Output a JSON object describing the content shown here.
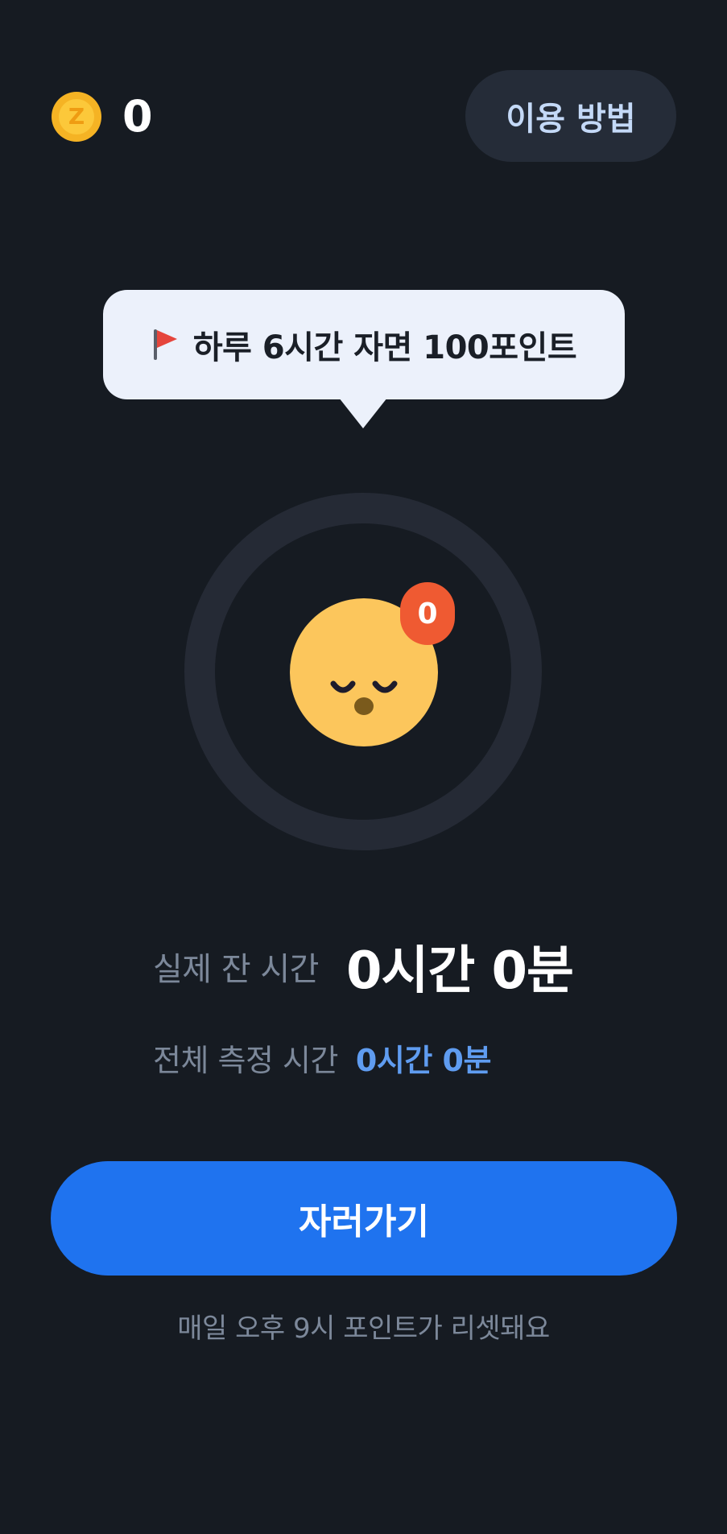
{
  "header": {
    "coin_symbol": "Z",
    "coin_count": "0",
    "help_label": "이용 방법"
  },
  "tooltip": {
    "icon": "flag-icon",
    "text": "하루 6시간 자면 100포인트"
  },
  "progress": {
    "face": "sleeping-face-icon",
    "badge_count": "0",
    "progress_fraction": 0
  },
  "stats": {
    "actual_sleep_label": "실제 잔 시간",
    "actual_sleep_value": "0시간 0분",
    "total_measured_label": "전체 측정 시간",
    "total_measured_value": "0시간 0분"
  },
  "action": {
    "sleep_button_label": "자러가기",
    "reset_notice": "매일 오후 9시 포인트가 리셋돼요"
  },
  "colors": {
    "background": "#161b22",
    "accent": "#1f73ef",
    "badge": "#ef5a32",
    "face": "#fcc65c",
    "coin": "#f5b324"
  }
}
